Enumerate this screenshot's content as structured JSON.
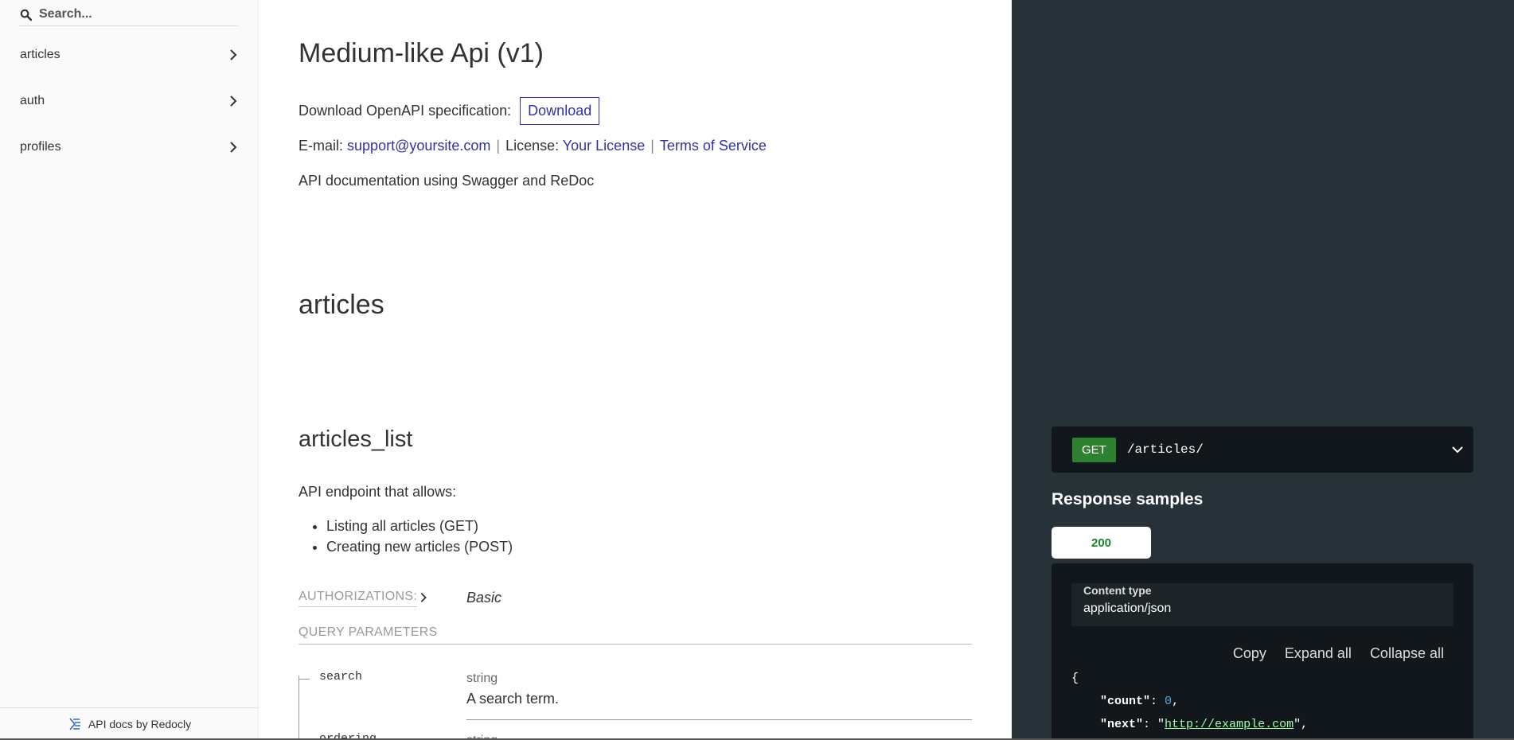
{
  "sidebar": {
    "search_placeholder": "Search...",
    "items": [
      {
        "label": "articles"
      },
      {
        "label": "auth"
      },
      {
        "label": "profiles"
      }
    ],
    "powered_by": "API docs by Redocly"
  },
  "info": {
    "title": "Medium-like Api (v1)",
    "download_text": "Download OpenAPI specification:",
    "download_button": "Download",
    "email_label": "E-mail:",
    "email": "support@yoursite.com",
    "license_label": "License:",
    "license": "Your License",
    "terms": "Terms of Service",
    "description": "API documentation using Swagger and ReDoc"
  },
  "section": {
    "title": "articles"
  },
  "operation": {
    "title": "articles_list",
    "description": "API endpoint that allows:",
    "bullets": [
      "Listing all articles (GET)",
      "Creating new articles (POST)"
    ],
    "authorizations_label": "AUTHORIZATIONS:",
    "authorizations_value": "Basic",
    "query_params_label": "QUERY PARAMETERS",
    "params": [
      {
        "name": "search",
        "type": "string",
        "description": "A search term."
      },
      {
        "name": "ordering",
        "type": "string",
        "description": ""
      }
    ]
  },
  "right_panel": {
    "method": "GET",
    "path": "/articles/",
    "response_samples_title": "Response samples",
    "status_tab": "200",
    "content_type_label": "Content type",
    "content_type_value": "application/json",
    "actions": {
      "copy": "Copy",
      "expand": "Expand all",
      "collapse": "Collapse all"
    },
    "code": {
      "open": "{",
      "count_key": "\"count\"",
      "count_val": "0",
      "next_key": "\"next\"",
      "next_val": "http://example.com"
    }
  },
  "colors": {
    "accent": "#32329f",
    "get_badge": "#2f8132",
    "right_panel_bg": "#263238",
    "status_200": "#1d8127"
  }
}
